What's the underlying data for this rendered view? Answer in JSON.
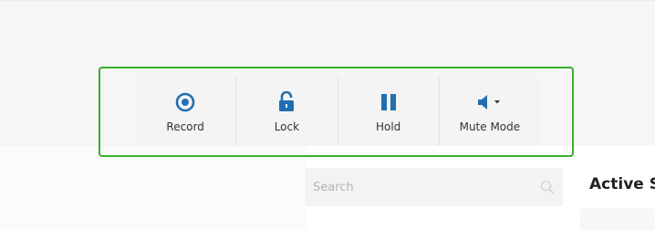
{
  "toolbar": {
    "record_label": "Record",
    "lock_label": "Lock",
    "hold_label": "Hold",
    "mute_label": "Mute Mode"
  },
  "search": {
    "placeholder": "Search"
  },
  "panel": {
    "heading": "Active S"
  },
  "colors": {
    "accent_blue": "#1f6fb2",
    "highlight_green": "#38b02b",
    "band_gray": "#f6f6f6"
  },
  "icons": {
    "record": "record-icon",
    "lock": "unlock-icon",
    "hold": "pause-icon",
    "mute": "speaker-icon",
    "mute_dropdown": "caret-down-icon",
    "search": "search-icon"
  }
}
